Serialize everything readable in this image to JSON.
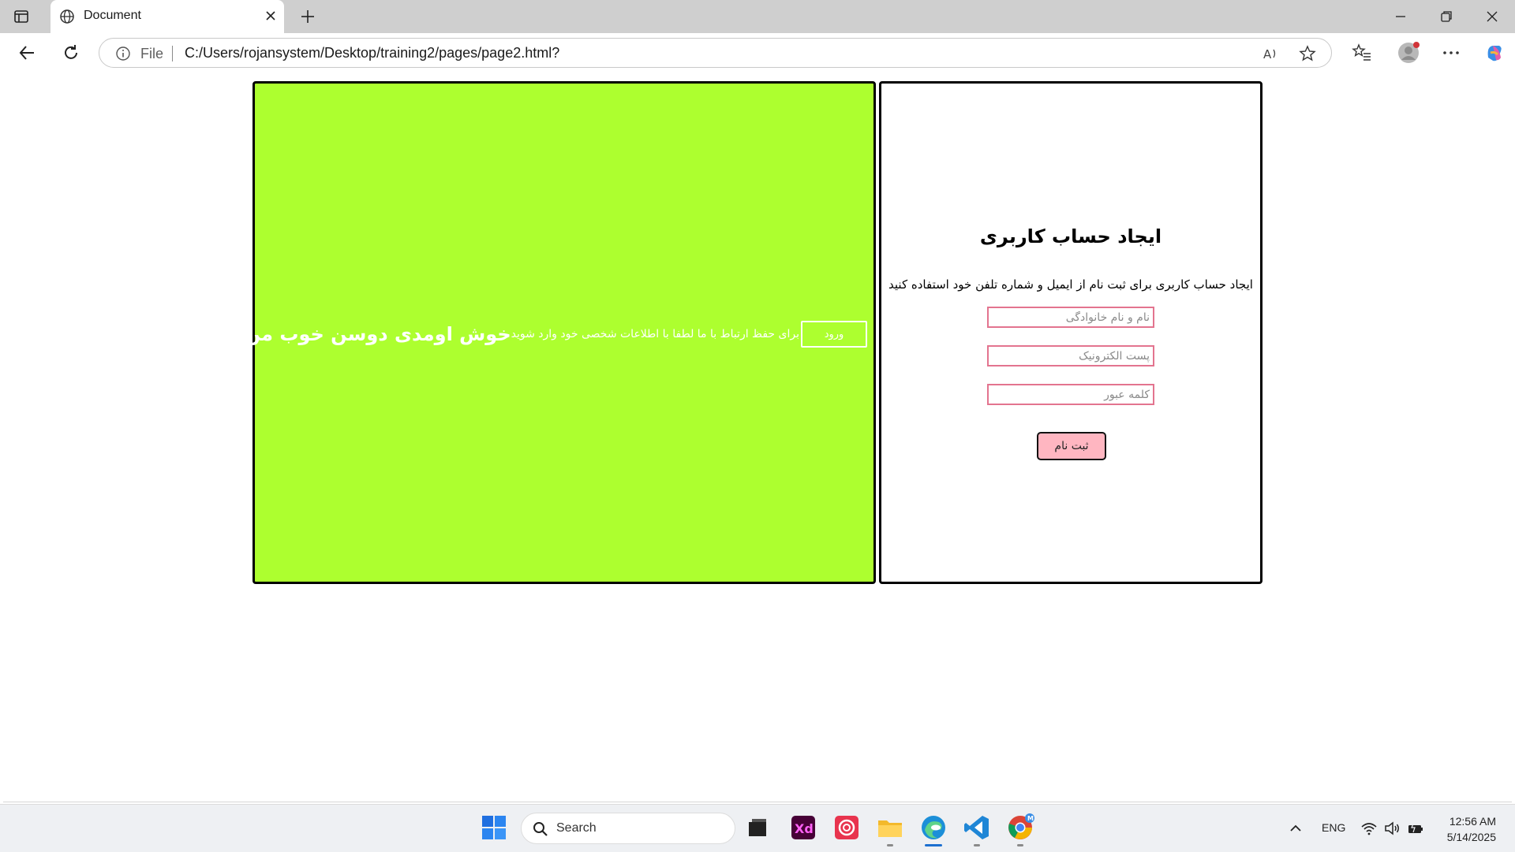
{
  "browser": {
    "tab_title": "Document",
    "address_prefix": "File",
    "url": "C:/Users/rojansystem/Desktop/training2/pages/page2.html?"
  },
  "page": {
    "welcome": {
      "title": "خوش اومدی دوسن خوب من",
      "text": "برای حفظ ارتباط با ما لطفا با اطلاعات شخصی خود وارد شوید",
      "login_button": "ورود"
    },
    "signup": {
      "title": "ایجاد حساب کاربری",
      "subtitle": "ایجاد حساب کاربری برای ثبت نام از ایمیل و شماره تلفن خود استفاده کنید",
      "name_placeholder": "نام و نام خانوادگی",
      "email_placeholder": "پست الکترونیک",
      "password_placeholder": "کلمه عبور",
      "submit_button": "ثبت نام"
    },
    "colors": {
      "welcome_bg": "#adff2f",
      "input_border": "#e3748f",
      "button_bg": "#ffb6c1"
    }
  },
  "taskbar": {
    "search_placeholder": "Search",
    "language": "ENG",
    "time": "12:56 AM",
    "date": "5/14/2025",
    "apps": [
      "windows-start-icon",
      "file-viewer-icon",
      "adobe-xd-icon",
      "creative-cloud-icon",
      "file-explorer-icon",
      "edge-icon",
      "vscode-icon",
      "chrome-icon"
    ]
  }
}
